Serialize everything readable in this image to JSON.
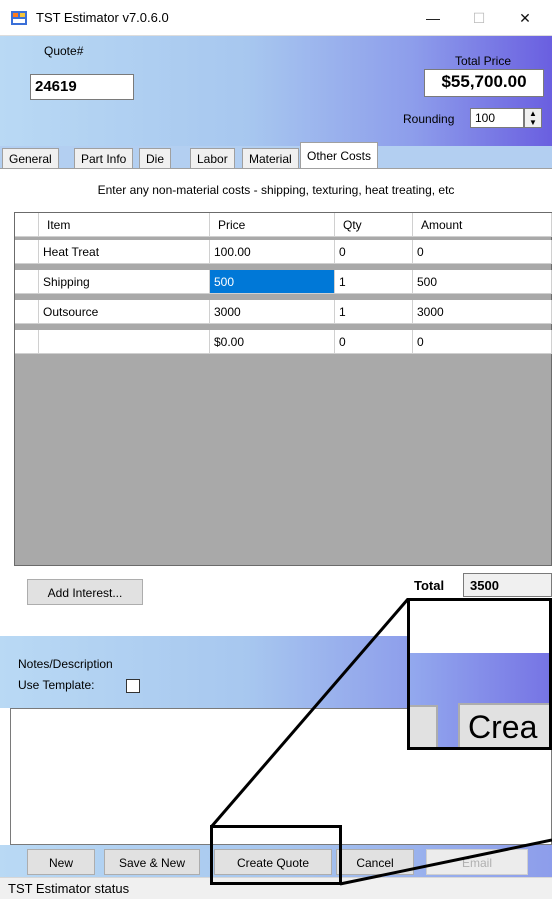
{
  "window": {
    "title": "TST Estimator v7.0.6.0",
    "controls": {
      "minimize": "—",
      "maximize": "☐",
      "close": "✕"
    }
  },
  "header": {
    "quote_label": "Quote#",
    "quote_value": "24619",
    "total_price_label": "Total Price",
    "total_price_value": "$55,700.00",
    "rounding_label": "Rounding",
    "rounding_value": "100"
  },
  "tabs": [
    {
      "label": "General"
    },
    {
      "label": "Part Info"
    },
    {
      "label": "Die"
    },
    {
      "label": "Labor"
    },
    {
      "label": "Material"
    },
    {
      "label": "Other Costs",
      "active": true
    }
  ],
  "other_costs": {
    "instructions": "Enter any non-material costs - shipping, texturing, heat treating, etc",
    "columns": [
      "Item",
      "Price",
      "Qty",
      "Amount"
    ],
    "rows": [
      {
        "item": "Heat Treat",
        "price": "100.00",
        "qty": "0",
        "amount": "0"
      },
      {
        "item": "Shipping",
        "price": "500",
        "qty": "1",
        "amount": "500",
        "selected_col": "price"
      },
      {
        "item": "Outsource",
        "price": "3000",
        "qty": "1",
        "amount": "3000"
      },
      {
        "item": "",
        "price": "$0.00",
        "qty": "0",
        "amount": "0"
      }
    ],
    "add_interest_label": "Add Interest...",
    "total_label": "Total",
    "total_value": "3500"
  },
  "notes": {
    "label": "Notes/Description",
    "use_template_label": "Use Template:",
    "use_template_checked": false,
    "text": ""
  },
  "footer": {
    "new_label": "New",
    "save_new_label": "Save & New",
    "create_quote_label": "Create Quote",
    "cancel_label": "Cancel",
    "email_label": "Email"
  },
  "status": {
    "text": "TST Estimator status"
  },
  "zoom_callout": {
    "text": "Crea"
  },
  "colors": {
    "selection": "#0078d7",
    "grid_empty": "#a9a9a9",
    "gradient_start": "#b9d9f4",
    "gradient_end": "#6a5fe0"
  }
}
